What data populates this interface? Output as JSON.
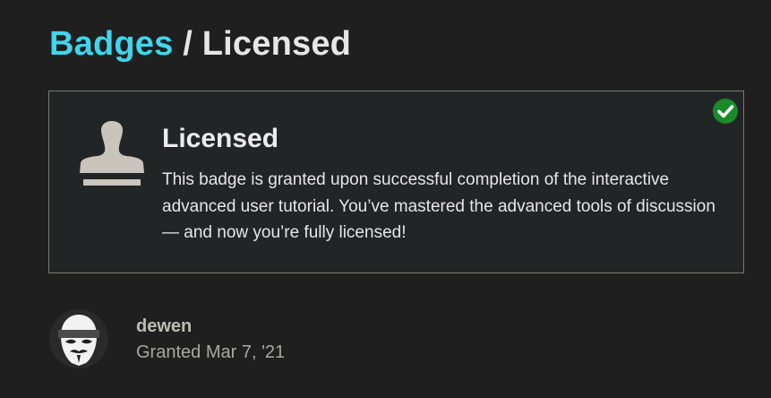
{
  "breadcrumb": {
    "parent_label": "Badges",
    "separator": "/",
    "current_label": "Licensed"
  },
  "badge": {
    "name": "Licensed",
    "description": "This badge is granted upon successful completion of the interactive advanced user tutorial. You’ve mastered the advanced tools of discussion — and now you’re fully licensed!",
    "icon": "stamp-icon",
    "granted_status_icon": "check-circle-icon"
  },
  "grant": {
    "username": "dewen",
    "granted_prefix": "Granted",
    "granted_date": "Mar 7, '21",
    "avatar_icon": "masked-avatar"
  },
  "colors": {
    "background": "#1f1f1f",
    "card_background": "#222526",
    "card_border": "#7a7a6e",
    "link_accent": "#3fd6ec",
    "check_green": "#1a8a2a",
    "icon_gray": "#c9c4bc"
  }
}
